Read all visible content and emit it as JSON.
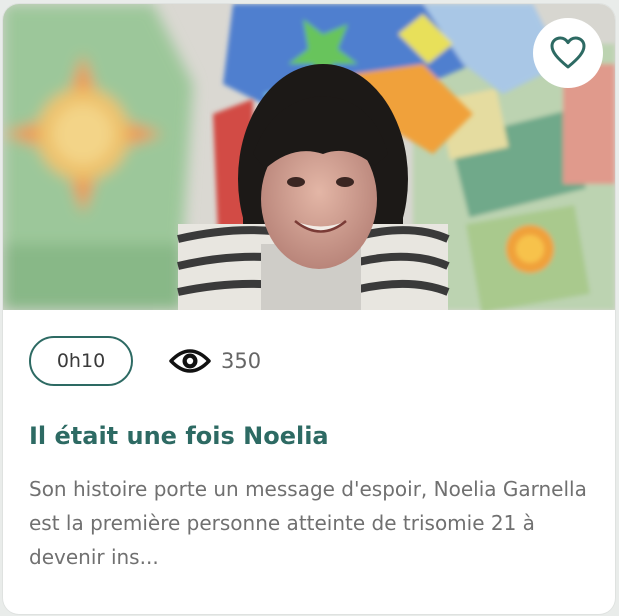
{
  "card": {
    "image_alt": "Noelia smiling under colorful blankets",
    "favorite_icon": "heart-outline-icon",
    "duration": "0h10",
    "views_icon": "eye-icon",
    "views": "350",
    "title": "Il était une fois Noelia",
    "description": "Son histoire porte un message d'espoir, Noelia Garnella est la première personne atteinte de trisomie 21 à devenir ins...",
    "colors": {
      "accent": "#2d6a63",
      "text_muted": "#707070",
      "background": "#ffffff"
    }
  }
}
